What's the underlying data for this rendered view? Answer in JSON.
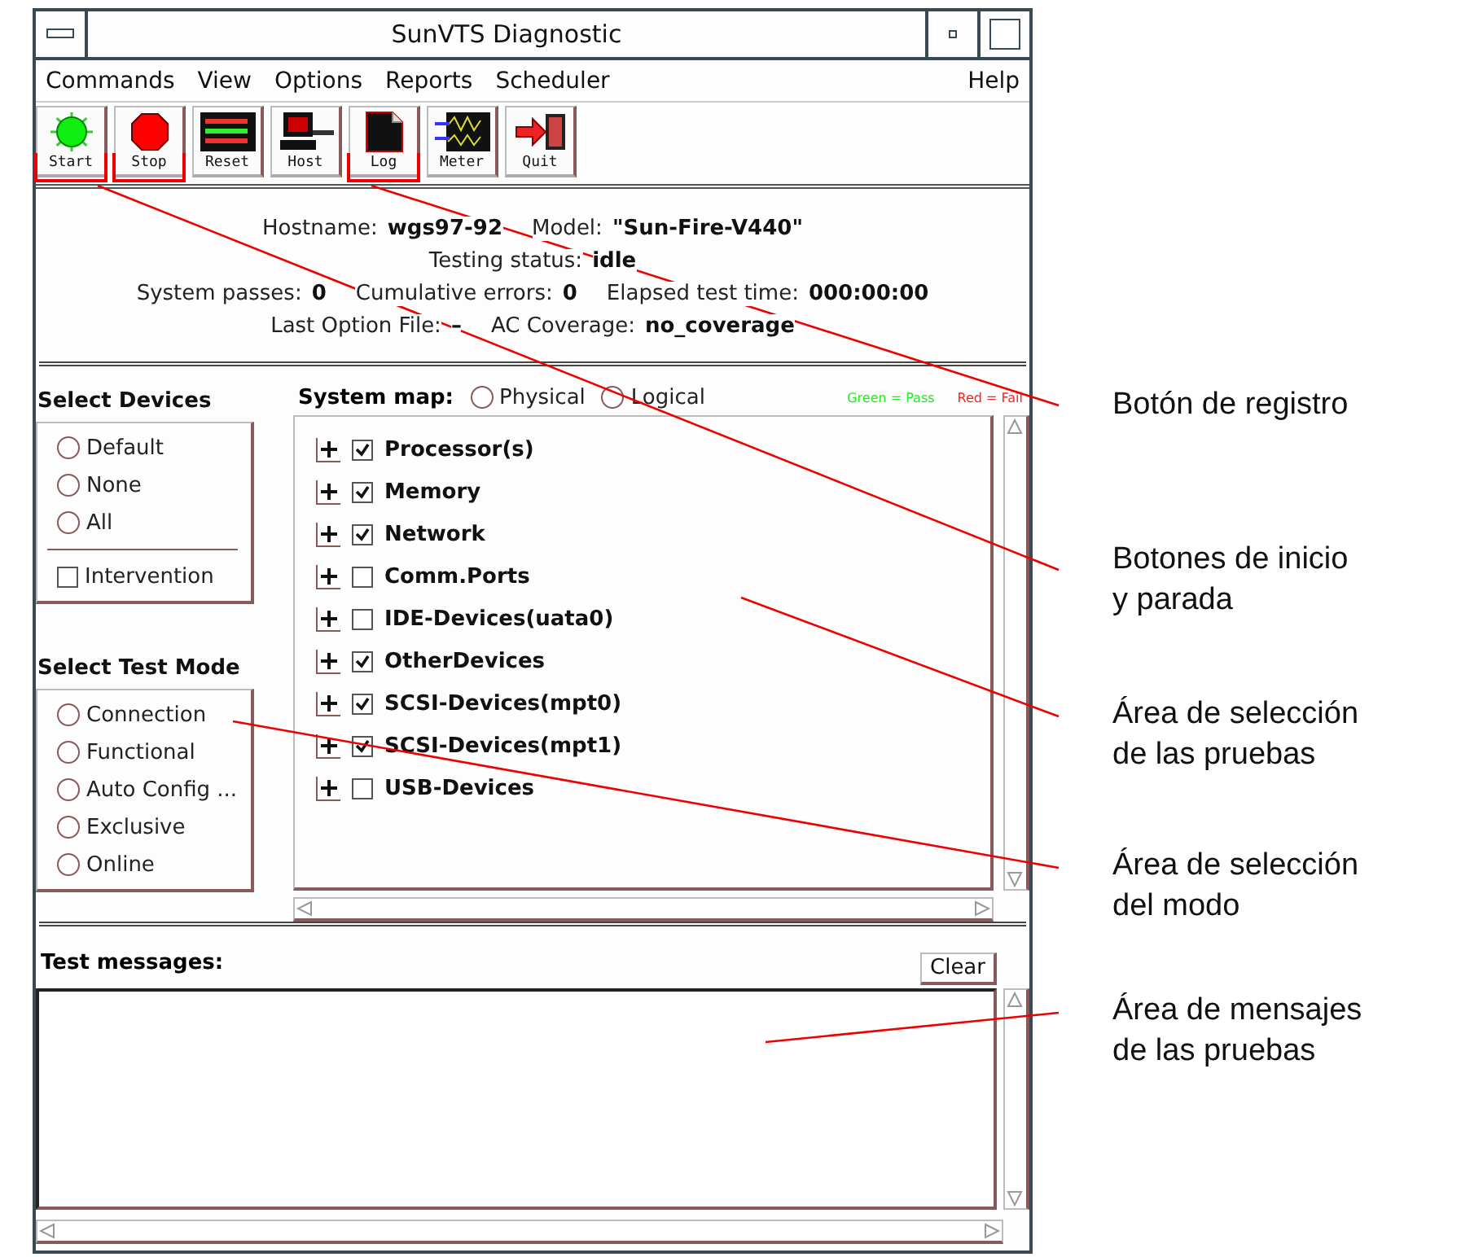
{
  "window": {
    "title": "SunVTS Diagnostic"
  },
  "menu": [
    {
      "label": "Commands"
    },
    {
      "label": "View"
    },
    {
      "label": "Options"
    },
    {
      "label": "Reports"
    },
    {
      "label": "Scheduler"
    }
  ],
  "help_menu": {
    "label": "Help"
  },
  "toolbar": [
    {
      "label": "Start",
      "kind": "start",
      "highlighted": true
    },
    {
      "label": "Stop",
      "kind": "stop",
      "highlighted": true
    },
    {
      "label": "Reset",
      "kind": "reset",
      "highlighted": false
    },
    {
      "label": "Host",
      "kind": "host",
      "highlighted": false
    },
    {
      "label": "Log",
      "kind": "log",
      "highlighted": true
    },
    {
      "label": "Meter",
      "kind": "meter",
      "highlighted": false
    },
    {
      "label": "Quit",
      "kind": "quit",
      "highlighted": false
    }
  ],
  "status": [
    [
      {
        "label": "Hostname:",
        "value": "wgs97-92"
      },
      {
        "label": "Model:",
        "value": "\"Sun-Fire-V440\""
      }
    ],
    [
      {
        "label": "Testing status:",
        "value": "idle"
      }
    ],
    [
      {
        "label": "System passes:",
        "value": "0"
      },
      {
        "label": "Cumulative errors:",
        "value": "0"
      },
      {
        "label": "Elapsed test time:",
        "value": "000:00:00"
      }
    ],
    [
      {
        "label": "Last Option File:",
        "value": "–"
      },
      {
        "label": "AC Coverage:",
        "value": "no_coverage"
      }
    ]
  ],
  "select_devices": {
    "title": "Select Devices",
    "options": [
      {
        "label": "Default",
        "selected": false
      },
      {
        "label": "None",
        "selected": false
      },
      {
        "label": "All",
        "selected": false
      }
    ],
    "intervention": {
      "label": "Intervention",
      "checked": false
    }
  },
  "test_mode": {
    "title": "Select Test Mode",
    "options": [
      {
        "label": "Connection",
        "selected": false
      },
      {
        "label": "Functional",
        "selected": false
      },
      {
        "label": "Auto Config ...",
        "selected": false
      },
      {
        "label": "Exclusive",
        "selected": false
      },
      {
        "label": "Online",
        "selected": false
      }
    ]
  },
  "system_map": {
    "label": "System map:",
    "views": [
      {
        "label": "Physical",
        "selected": false
      },
      {
        "label": "Logical",
        "selected": false
      }
    ],
    "legend": [
      {
        "label": "Green = Pass",
        "color": "#22ee22"
      },
      {
        "label": "Red = Fail",
        "color": "#ff2222"
      }
    ],
    "items": [
      {
        "label": "Processor(s)",
        "checked": true
      },
      {
        "label": "Memory",
        "checked": true
      },
      {
        "label": "Network",
        "checked": true
      },
      {
        "label": "Comm.Ports",
        "checked": false
      },
      {
        "label": "IDE-Devices(uata0)",
        "checked": false
      },
      {
        "label": "OtherDevices",
        "checked": true
      },
      {
        "label": "SCSI-Devices(mpt0)",
        "checked": true
      },
      {
        "label": "SCSI-Devices(mpt1)",
        "checked": true
      },
      {
        "label": "USB-Devices",
        "checked": false
      }
    ]
  },
  "messages": {
    "title": "Test messages:",
    "clear_button": "Clear"
  },
  "callouts": [
    {
      "lines": [
        "Botón de registro"
      ]
    },
    {
      "lines": [
        "Botones de inicio",
        "y parada"
      ]
    },
    {
      "lines": [
        "Área de selección",
        "de las pruebas"
      ]
    },
    {
      "lines": [
        "Área de selección",
        "del modo"
      ]
    },
    {
      "lines": [
        "Área de mensajes",
        "de las pruebas"
      ]
    }
  ]
}
